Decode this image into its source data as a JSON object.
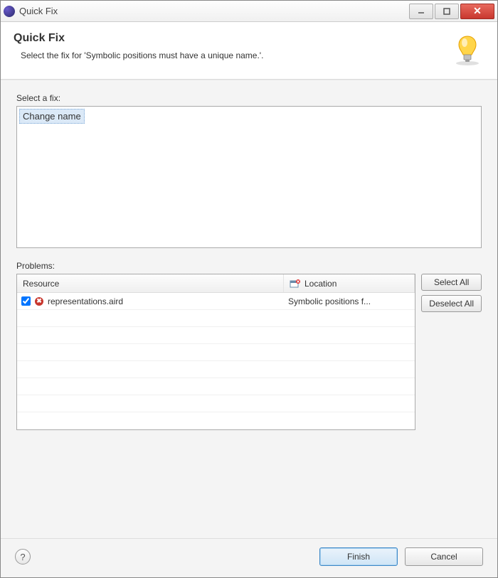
{
  "titlebar": {
    "title": "Quick Fix"
  },
  "header": {
    "title": "Quick Fix",
    "subtitle": "Select the fix for 'Symbolic positions must have a unique name.'."
  },
  "fixes": {
    "label": "Select a fix:",
    "items": [
      {
        "label": "Change name"
      }
    ]
  },
  "problems": {
    "label": "Problems:",
    "columns": {
      "resource": "Resource",
      "location": "Location"
    },
    "rows": [
      {
        "checked": true,
        "resource": "representations.aird",
        "location": "Symbolic positions f..."
      }
    ]
  },
  "buttons": {
    "select_all": "Select All",
    "deselect_all": "Deselect All",
    "finish": "Finish",
    "cancel": "Cancel"
  }
}
